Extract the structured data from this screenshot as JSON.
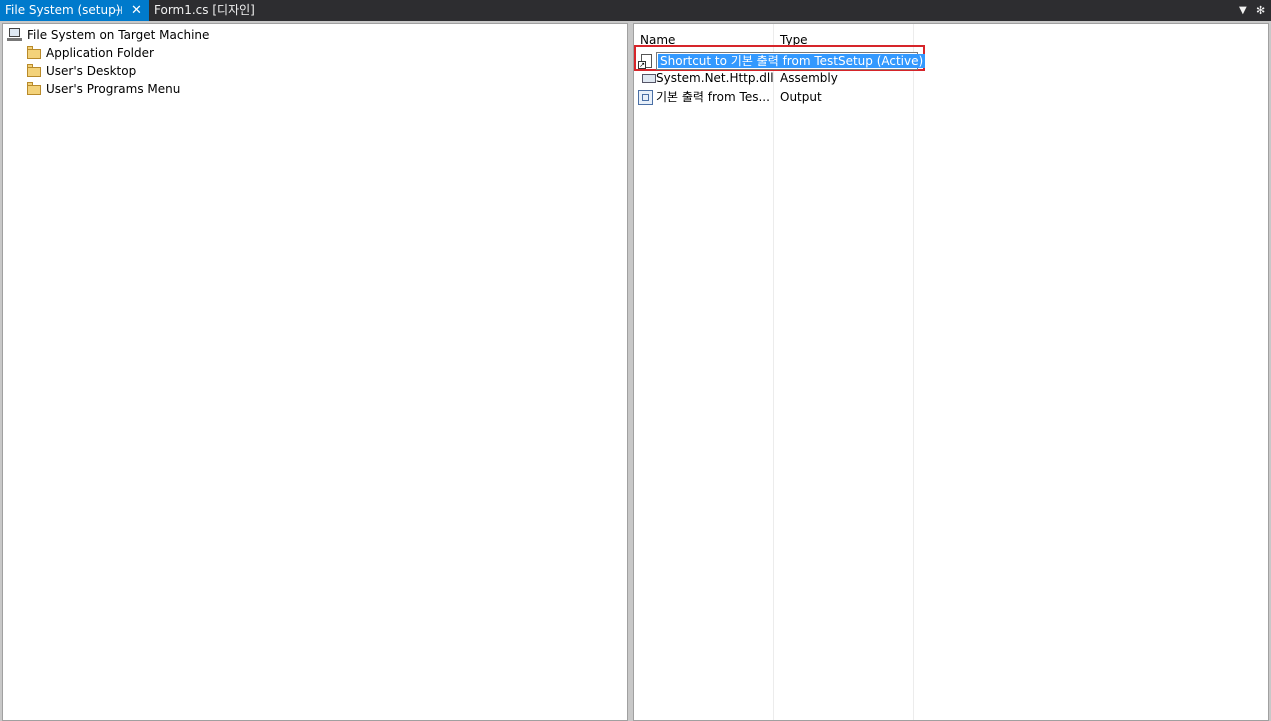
{
  "tabs": [
    {
      "label": "File System (setup)",
      "active": true
    },
    {
      "label": "Form1.cs [디자인]",
      "active": false
    }
  ],
  "tab_icons": {
    "pin": "pin-icon",
    "close": "close-icon",
    "dropdown": "dropdown-icon",
    "settings": "gear-icon"
  },
  "tree": {
    "root": "File System on Target Machine",
    "children": [
      "Application Folder",
      "User's Desktop",
      "User's Programs Menu"
    ]
  },
  "list": {
    "columns": [
      "Name",
      "Type"
    ],
    "editing": {
      "value": "Shortcut to 기본 출력 from TestSetup (Active)"
    },
    "rows": [
      {
        "name": "System.Net.Http.dll",
        "type": "Assembly"
      },
      {
        "name": "기본 출력 from Tes...",
        "type": "Output"
      }
    ]
  },
  "colors": {
    "accent": "#007acc",
    "highlight_border": "#d6252a",
    "selection": "#3399ff"
  }
}
